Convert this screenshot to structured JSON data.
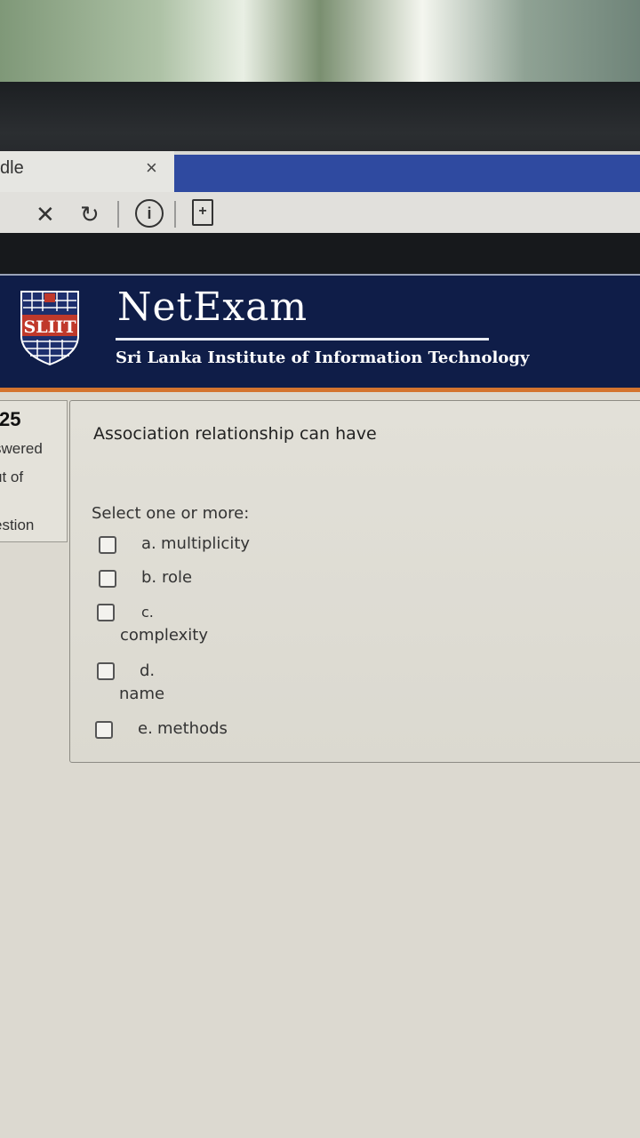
{
  "browser": {
    "tab_title": "dle",
    "tab_close_glyph": "×",
    "stop_glyph": "✕",
    "reload_glyph": "↻",
    "info_glyph": "i",
    "page_glyph": "+"
  },
  "header": {
    "brand": "NetExam",
    "institute": "Sri Lanka Institute of Information Technology",
    "logo_text": "SLIIT",
    "colors": {
      "header_bg": "#0f1d48",
      "accent": "#d4742f"
    }
  },
  "info_panel": {
    "question_number": "25",
    "status": "swered",
    "marks": "ut of",
    "flag": "estion"
  },
  "question": {
    "text": "Association relationship can have",
    "prompt": "Select one or more:",
    "options": [
      {
        "letter": "a.",
        "text": "multiplicity",
        "checked": false
      },
      {
        "letter": "b.",
        "text": "role",
        "checked": false
      },
      {
        "letter": "c.",
        "text": "complexity",
        "checked": false
      },
      {
        "letter": "d.",
        "text": "name",
        "checked": false
      },
      {
        "letter": "e.",
        "text": "methods",
        "checked": false
      }
    ]
  }
}
